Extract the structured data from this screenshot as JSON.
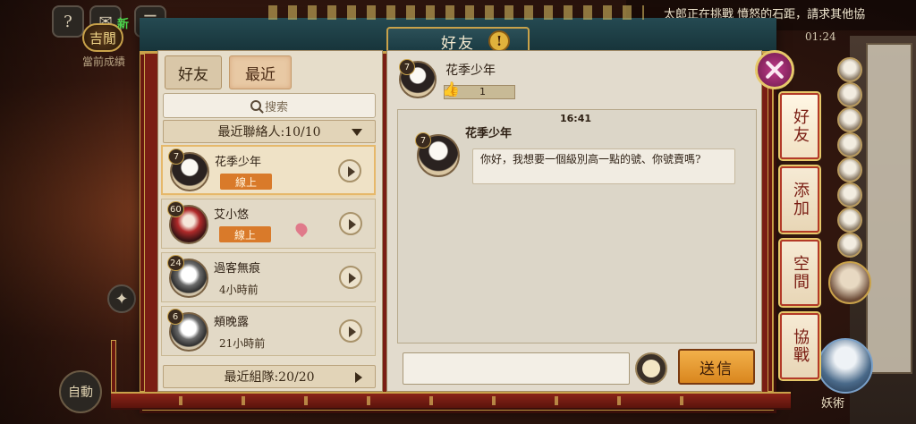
{
  "hud": {
    "jige_label": "吉閒",
    "new_badge": "新",
    "bg_text": "當前成績",
    "auto_label": "自動",
    "marquee": "太郎正在挑戰 憤怒的石距，請求其他協",
    "timer": "01:24",
    "yaoshu_label": "妖術"
  },
  "dialog": {
    "title": "好友",
    "warn_glyph": "!"
  },
  "left": {
    "tabs": [
      {
        "label": "好友",
        "active": true
      },
      {
        "label": "最近",
        "active": false
      }
    ],
    "search_placeholder": "搜索",
    "recent_contacts_label": "最近聯絡人:10/10",
    "recent_team_label": "最近組隊:20/20",
    "contacts": [
      {
        "level": "7",
        "name": "花季少年",
        "status": "線上",
        "online": true,
        "selected": true
      },
      {
        "level": "60",
        "name": "艾小悠",
        "status": "線上",
        "online": true,
        "selected": false
      },
      {
        "level": "24",
        "name": "過客無痕",
        "status": "4小時前",
        "online": false,
        "selected": false
      },
      {
        "level": "6",
        "name": "頰晚露",
        "status": "21小時前",
        "online": false,
        "selected": false
      }
    ]
  },
  "right": {
    "friend": {
      "level": "7",
      "name": "花季少年",
      "likes": "1"
    },
    "chat": {
      "time": "16:41",
      "messages": [
        {
          "level": "7",
          "sender": "花季少年",
          "text": "你好，我想要一個級別高一點的號、你號賣嗎?"
        }
      ]
    },
    "input_value": "",
    "send_label": "送信"
  },
  "side_tabs": [
    "好友",
    "添加",
    "空間",
    "協戰"
  ]
}
